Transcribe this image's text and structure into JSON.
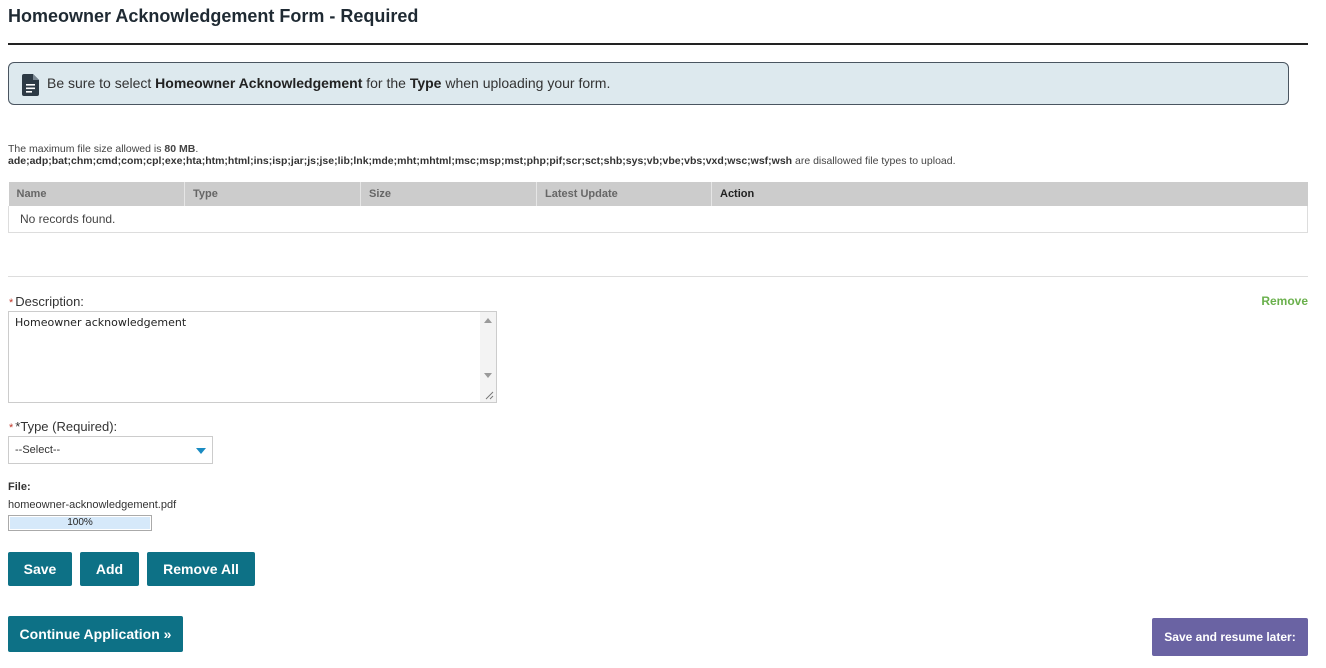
{
  "page": {
    "title": "Homeowner Acknowledgement Form - Required"
  },
  "notice": {
    "icon": "document-icon",
    "text_1": "Be sure to select ",
    "bold_1": "Homeowner Acknowledgement",
    "text_2": " for the ",
    "bold_2": "Type",
    "text_3": " when uploading your form."
  },
  "upload_info": {
    "max_size_prefix": "The maximum file size allowed is ",
    "max_size_value": "80 MB",
    "max_size_suffix": ".",
    "disallowed_types": "ade;adp;bat;chm;cmd;com;cpl;exe;hta;htm;html;ins;isp;jar;js;jse;lib;lnk;mde;mht;mhtml;msc;msp;mst;php;pif;scr;sct;shb;sys;vb;vbe;vbs;vxd;wsc;wsf;wsh",
    "disallowed_suffix": " are disallowed file types to upload."
  },
  "table": {
    "columns": [
      "Name",
      "Type",
      "Size",
      "Latest Update",
      "Action"
    ],
    "empty_text": "No records found."
  },
  "form": {
    "required_mark": "*",
    "description_label": "Description:",
    "description_value": "Homeowner acknowledgement",
    "remove_link": "Remove",
    "type_label": "*Type (Required):",
    "type_selected": "--Select--",
    "file_label": "File:",
    "file_name": "homeowner-acknowledgement.pdf",
    "progress": 100,
    "progress_text": "100%"
  },
  "buttons": {
    "save": "Save",
    "add": "Add",
    "remove_all": "Remove All",
    "continue": "Continue Application »",
    "save_later": "Save and resume later:"
  },
  "colors": {
    "primary_button": "#0d7186",
    "secondary_button": "#6a63a3",
    "remove_link": "#6ab04c",
    "notice_background": "#dde9ee"
  }
}
